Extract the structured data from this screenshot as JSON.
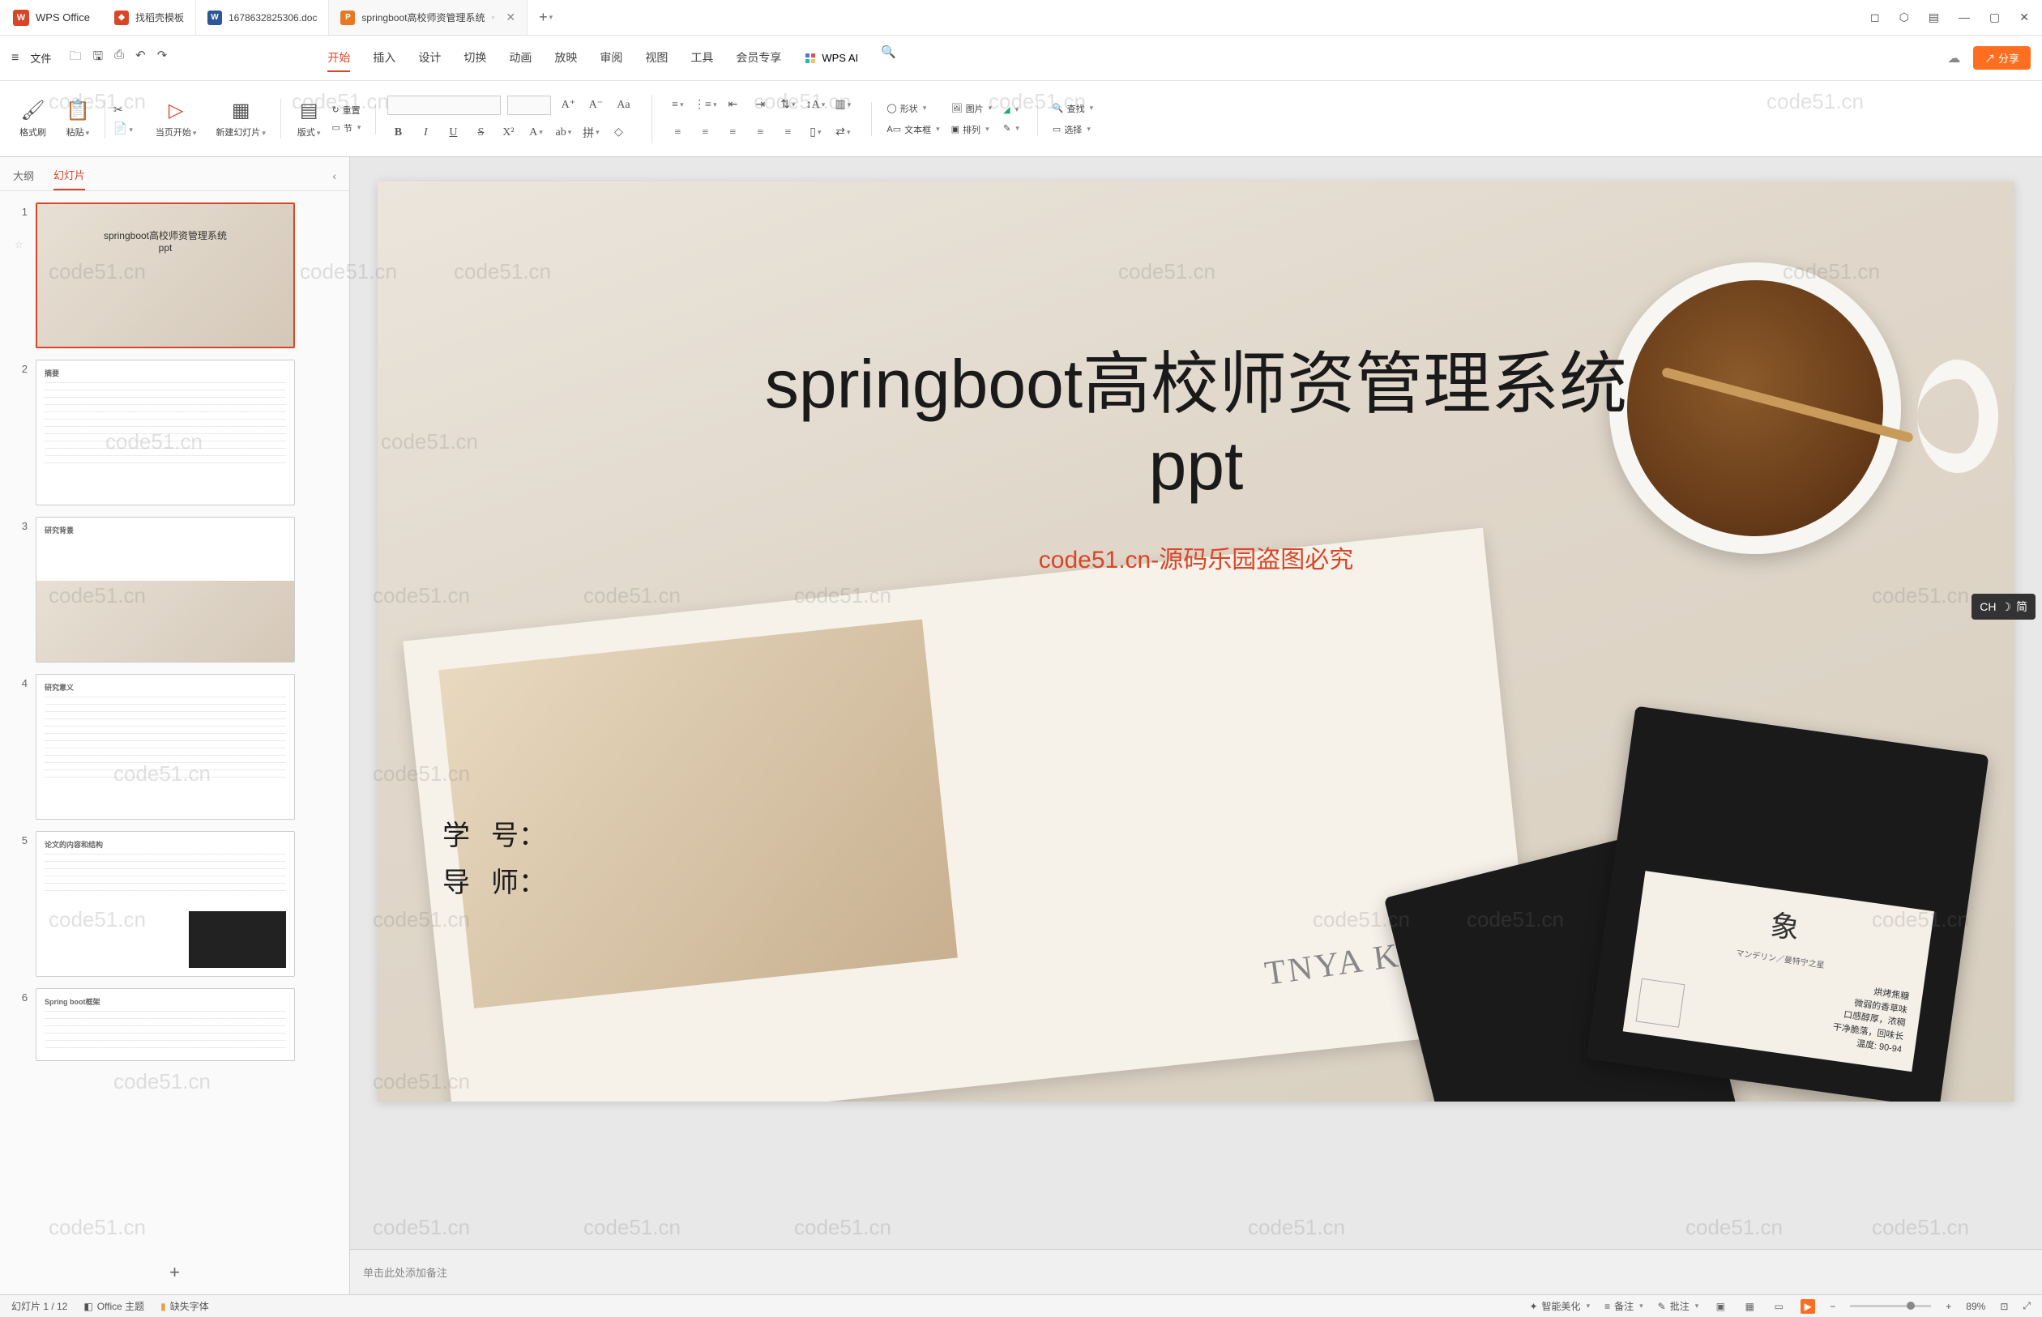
{
  "app": {
    "name": "WPS Office"
  },
  "tabs": [
    {
      "label": "找稻壳模板",
      "icon": "red"
    },
    {
      "label": "1678632825306.doc",
      "icon": "blue"
    },
    {
      "label": "springboot高校师资管理系统",
      "icon": "orange",
      "active": true
    }
  ],
  "menu": {
    "file": "文件",
    "items": [
      "开始",
      "插入",
      "设计",
      "切换",
      "动画",
      "放映",
      "审阅",
      "视图",
      "工具",
      "会员专享"
    ],
    "ai": "WPS AI",
    "share": "分享"
  },
  "ribbon": {
    "format_brush": "格式刷",
    "paste": "粘贴",
    "from_current": "当页开始",
    "new_slide": "新建幻灯片",
    "layout": "版式",
    "section": "节",
    "reset": "重置",
    "font_dd": "▾",
    "shape": "形状",
    "image": "图片",
    "textbox": "文本框",
    "arrange": "排列",
    "find": "查找",
    "select": "选择"
  },
  "sidepanel": {
    "tab_outline": "大纲",
    "tab_slides": "幻灯片",
    "slides": [
      {
        "num": "1",
        "title": "springboot高校师资管理系统\nppt"
      },
      {
        "num": "2",
        "title": "摘要"
      },
      {
        "num": "3",
        "title": "研究背景"
      },
      {
        "num": "4",
        "title": "研究意义"
      },
      {
        "num": "5",
        "title": "论文的内容和结构"
      },
      {
        "num": "6",
        "title": "Spring boot框架"
      }
    ]
  },
  "slide": {
    "title": "springboot高校师资管理系统\nppt",
    "watermark": "code51.cn-源码乐园盗图必究",
    "field1_label": "学",
    "field1_label2": "号：",
    "field2_label": "导",
    "field2_label2": "师：",
    "book_text": "TNYA KOPI",
    "bag_char": "象",
    "bag_sub": "マンデリン／曼特宁之星",
    "bag_line1": "烘烤焦糖",
    "bag_line2": "微弱的香草味",
    "bag_line3": "口感醇厚，浓稠",
    "bag_line4": "干净脆落，回味长",
    "bag_line5": "温度: 90-94"
  },
  "notes": {
    "placeholder": "单击此处添加备注"
  },
  "ime": {
    "lang": "CH",
    "mode": "简"
  },
  "status": {
    "slide_pos": "幻灯片 1 / 12",
    "theme": "Office 主题",
    "missing_font": "缺失字体",
    "beautify": "智能美化",
    "notes": "备注",
    "comments": "批注",
    "zoom": "89%"
  },
  "wm_text": "code51.cn"
}
